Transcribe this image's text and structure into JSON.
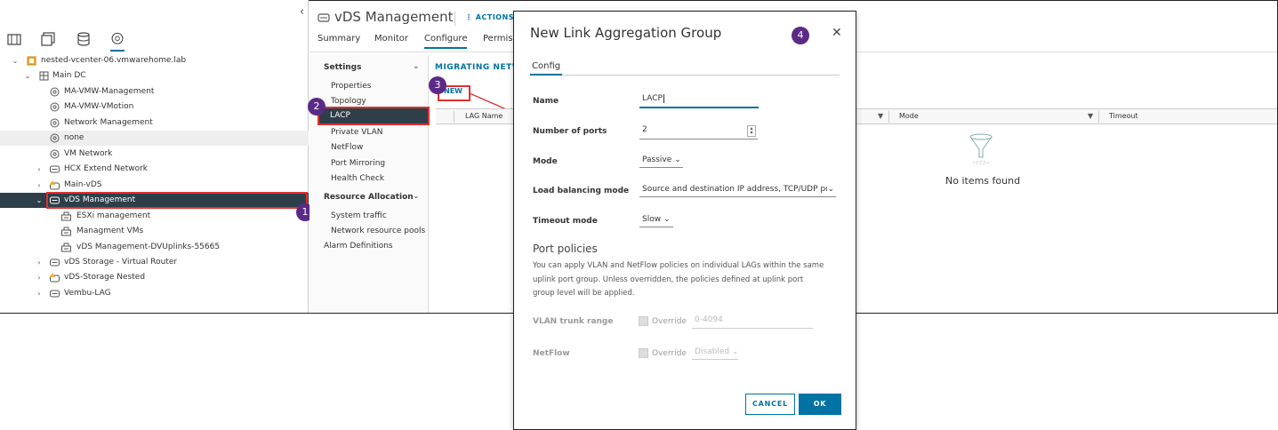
{
  "header": {
    "title": "vDS Management",
    "actions": "ACTIONS"
  },
  "tabs": [
    "Summary",
    "Monitor",
    "Configure",
    "Permiss"
  ],
  "nav_icons": [
    "hosts-clusters-icon",
    "vms-templates-icon",
    "storage-icon",
    "networking-icon"
  ],
  "tree": [
    {
      "label": "nested-vcenter-06.vmwarehome.lab",
      "icon": "vcenter-icon"
    },
    {
      "label": "Main DC",
      "icon": "datacenter-icon"
    },
    {
      "label": "MA-VMW-Management",
      "icon": "network-icon"
    },
    {
      "label": "MA-VMW-VMotion",
      "icon": "network-icon"
    },
    {
      "label": "Network Management",
      "icon": "network-icon"
    },
    {
      "label": "none",
      "icon": "network-icon"
    },
    {
      "label": "VM Network",
      "icon": "network-icon"
    },
    {
      "label": "HCX Extend Network",
      "icon": "switch-icon"
    },
    {
      "label": "Main-vDS",
      "icon": "switch-warning-icon"
    },
    {
      "label": "vDS Management",
      "icon": "switch-icon"
    },
    {
      "label": "ESXi management",
      "icon": "portgroup-icon"
    },
    {
      "label": "Managment VMs",
      "icon": "portgroup-icon"
    },
    {
      "label": "vDS Management-DVUplinks-55665",
      "icon": "portgroup-icon"
    },
    {
      "label": "vDS Storage - Virtual Router",
      "icon": "switch-icon"
    },
    {
      "label": "vDS-Storage Nested",
      "icon": "switch-warning-icon"
    },
    {
      "label": "Vembu-LAG",
      "icon": "switch-icon"
    }
  ],
  "config_nav": {
    "settings": "Settings",
    "items": [
      "Properties",
      "Topology",
      "LACP",
      "Private VLAN",
      "NetFlow",
      "Port Mirroring",
      "Health Check"
    ],
    "resource_allocation": "Resource Allocation",
    "resource_items": [
      "System traffic",
      "Network resource pools"
    ],
    "alarm": "Alarm Definitions"
  },
  "content": {
    "migrating": "MIGRATING NETWO",
    "new_button": "NEW",
    "columns": [
      "LAG Name",
      "Mode",
      "Timeout"
    ],
    "empty": "No items found"
  },
  "dialog": {
    "title": "New Link Aggregation Group",
    "tab": "Config",
    "name_label": "Name",
    "name_value": "LACP",
    "ports_label": "Number of ports",
    "ports_value": "2",
    "mode_label": "Mode",
    "mode_value": "Passive",
    "lb_label": "Load balancing mode",
    "lb_value": "Source and destination IP address, TCP/UDP por",
    "timeout_label": "Timeout mode",
    "timeout_value": "Slow",
    "port_policies": "Port policies",
    "policy_desc": "You can apply VLAN and NetFlow policies on individual LAGs within the same uplink port group. Unless overridden, the policies defined at uplink port group level will be applied.",
    "vlan_label": "VLAN trunk range",
    "override": "Override",
    "vlan_value": "0-4094",
    "netflow_label": "NetFlow",
    "netflow_value": "Disabled",
    "cancel": "CANCEL",
    "ok": "OK"
  },
  "badges": [
    "1",
    "2",
    "3",
    "4"
  ],
  "colors": {
    "accent": "#0072a3",
    "selected": "#2e3f4a",
    "annotation": "#e03030",
    "badge": "#5b2a86"
  }
}
